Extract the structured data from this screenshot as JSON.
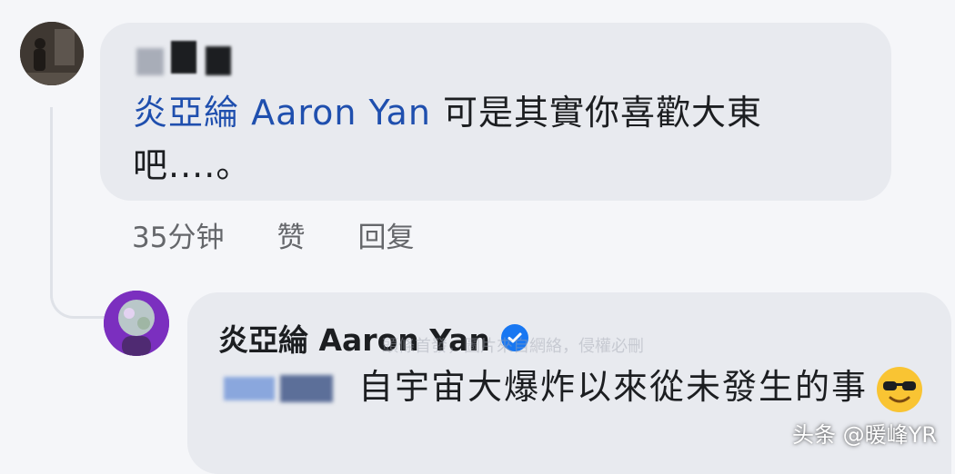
{
  "comment": {
    "mention": "炎亞綸 Aaron Yan",
    "text": "可是其實你喜歡大東吧....。",
    "time": "35分钟",
    "like_label": "赞",
    "reply_label": "回复"
  },
  "reply": {
    "author": "炎亞綸 Aaron Yan",
    "text": "自宇宙大爆炸以來從未發生的事",
    "watermark": "頭條首發，圖片來自網絡，侵權必刪"
  },
  "source_tag": "头条 @暖峰YR",
  "colors": {
    "mention": "#1f4fae",
    "bubble": "#e8eaef",
    "meta": "#65676b",
    "verified": "#1877f2"
  },
  "icons": [
    "verified-badge-icon",
    "sunglasses-emoji-icon"
  ]
}
